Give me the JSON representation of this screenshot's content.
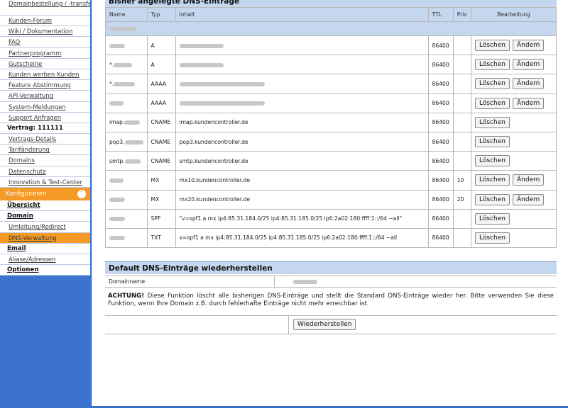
{
  "sidebar": {
    "items": [
      {
        "label": "Domainbestellung / -transfer"
      },
      {
        "label": "Kunden-Forum"
      },
      {
        "label": "Wiki / Dokumentation"
      },
      {
        "label": "FAQ"
      },
      {
        "label": "Partnerprogramm"
      },
      {
        "label": "Gutscheine"
      },
      {
        "label": "Kunden werben Kunden"
      },
      {
        "label": "Feature Abstimmung"
      },
      {
        "label": "API-Verwaltung"
      },
      {
        "label": "System-Meldungen"
      },
      {
        "label": "Support Anfragen"
      }
    ],
    "contract_label": "Vertrag: 111111",
    "contract_items": [
      {
        "label": "Vertrags-Details"
      },
      {
        "label": "Tarifänderung"
      },
      {
        "label": "Domains"
      },
      {
        "label": "Datenschutz"
      },
      {
        "label": "Innovation & Test-Center"
      }
    ],
    "configure_label": "Konfigurieren",
    "overview_label": "Übersicht",
    "domain_label": "Domain",
    "redirect_label": "Umleitung/Redirect",
    "dns_label": "DNS-Verwaltung",
    "email_label": "Email",
    "aliases_label": "Aliase/Adressen",
    "options_label": "Optionen"
  },
  "dns_table": {
    "title": "Bisher angelegte DNS-Einträge",
    "headers": {
      "name": "Name",
      "type": "Typ",
      "content": "Inhalt",
      "ttl": "TTL",
      "prio": "Prio",
      "actions": "Bearbeitung"
    },
    "delete_label": "Löschen",
    "edit_label": "Ändern",
    "rows": [
      {
        "name": "",
        "type": "A",
        "content": "",
        "ttl": "86400",
        "prio": "",
        "editable": true
      },
      {
        "name": "*.",
        "type": "A",
        "content": "",
        "ttl": "86400",
        "prio": "",
        "editable": true
      },
      {
        "name": "*.",
        "type": "AAAA",
        "content": "",
        "ttl": "86400",
        "prio": "",
        "editable": true
      },
      {
        "name": "",
        "type": "AAAA",
        "content": "",
        "ttl": "86400",
        "prio": "",
        "editable": true
      },
      {
        "name": "imap.",
        "type": "CNAME",
        "content": "imap.kundencontroller.de",
        "ttl": "86400",
        "prio": "",
        "editable": false
      },
      {
        "name": "pop3.",
        "type": "CNAME",
        "content": "pop3.kundencontroller.de",
        "ttl": "86400",
        "prio": "",
        "editable": false
      },
      {
        "name": "smtp.",
        "type": "CNAME",
        "content": "smtp.kundencontroller.de",
        "ttl": "86400",
        "prio": "",
        "editable": false
      },
      {
        "name": "",
        "type": "MX",
        "content": "mx10.kundencontroller.de",
        "ttl": "86400",
        "prio": "10",
        "editable": true
      },
      {
        "name": "",
        "type": "MX",
        "content": "mx20.kundencontroller.de",
        "ttl": "86400",
        "prio": "20",
        "editable": true
      },
      {
        "name": "",
        "type": "SPF",
        "content": "\"v=spf1 a mx ip4:85.31.184.0/25 ip4:85.31.185.0/25 ip6:2a02:180:ffff:1::/64 ~all\"",
        "ttl": "86400",
        "prio": "",
        "editable": false
      },
      {
        "name": "",
        "type": "TXT",
        "content": "v=spf1 a mx ip4:85.31.184.0/25 ip4:85.31.185.0/25 ip6:2a02:180:ffff:1::/64 ~all",
        "ttl": "86400",
        "prio": "",
        "editable": false
      }
    ]
  },
  "restore": {
    "title": "Default DNS-Einträge wiederherstellen",
    "domain_label": "Domainname",
    "warning_strong": "ACHTUNG!",
    "warning_text": " Diese Funktion löscht alle bisherigen DNS-Einträge und stellt die Standard DNS-Einträge wieder her. Bitte verwenden Sie diese Funktion, wenn Ihre Domain z.B. durch fehlerhafte Einträge nicht mehr erreichbar ist.",
    "button_label": "Wiederherstellen"
  }
}
